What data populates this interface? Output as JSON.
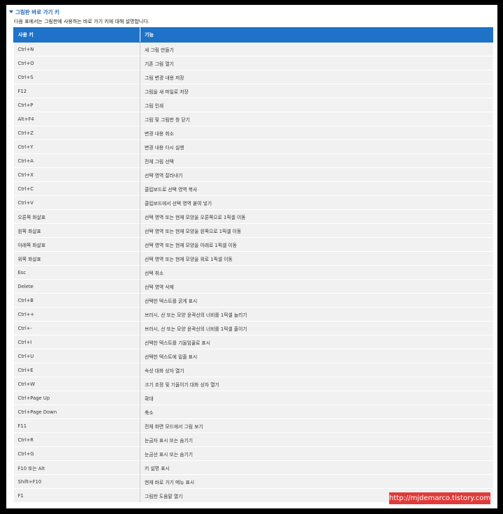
{
  "section": {
    "title": "그림판 바로 가기 키"
  },
  "intro": "다음 표에서는 그림판에 사용하는 바로 가기 키에 대해 설명합니다.",
  "columns": [
    "사용 키",
    "기능"
  ],
  "rows": [
    [
      "Ctrl+N",
      "새 그림 만들기"
    ],
    [
      "Ctrl+O",
      "기존 그림 열기"
    ],
    [
      "Ctrl+S",
      "그림 변경 내용 저장"
    ],
    [
      "F12",
      "그림을 새 파일로 저장"
    ],
    [
      "Ctrl+P",
      "그림 인쇄"
    ],
    [
      "Alt+F4",
      "그림 및 그림판 창 닫기"
    ],
    [
      "Ctrl+Z",
      "변경 내용 취소"
    ],
    [
      "Ctrl+Y",
      "변경 내용 다시 실행"
    ],
    [
      "Ctrl+A",
      "전체 그림 선택"
    ],
    [
      "Ctrl+X",
      "선택 영역 잘라내기"
    ],
    [
      "Ctrl+C",
      "클립보드로 선택 영역 복사"
    ],
    [
      "Ctrl+V",
      "클립보드에서 선택 영역 붙여 넣기"
    ],
    [
      "오른쪽 화살표",
      "선택 영역 또는 현재 모양을 오른쪽으로 1픽셀 이동"
    ],
    [
      "왼쪽 화살표",
      "선택 영역 또는 현재 모양을 왼쪽으로 1픽셀 이동"
    ],
    [
      "아래쪽 화살표",
      "선택 영역 또는 현재 모양을 아래로 1픽셀 이동"
    ],
    [
      "위쪽 화살표",
      "선택 영역 또는 현재 모양을 위로 1픽셀 이동"
    ],
    [
      "Esc",
      "선택 취소"
    ],
    [
      "Delete",
      "선택 영역 삭제"
    ],
    [
      "Ctrl+B",
      "선택한 텍스트를 굵게 표시"
    ],
    [
      "Ctrl++",
      "브러시, 선 또는 모양 윤곽선의 너비를 1픽셀 늘리기"
    ],
    [
      "Ctrl+-",
      "브러시, 선 또는 모양 윤곽선의 너비를 1픽셀 줄이기"
    ],
    [
      "Ctrl+I",
      "선택한 텍스트를 기울임꼴로 표시"
    ],
    [
      "Ctrl+U",
      "선택한 텍스트에 밑줄 표시"
    ],
    [
      "Ctrl+E",
      "속성 대화 상자 열기"
    ],
    [
      "Ctrl+W",
      "크기 조정 및 기울이기 대화 상자 열기"
    ],
    [
      "Ctrl+Page Up",
      "확대"
    ],
    [
      "Ctrl+Page Down",
      "축소"
    ],
    [
      "F11",
      "전체 화면 모드에서 그림 보기"
    ],
    [
      "Ctrl+R",
      "눈금자 표시 또는 숨기기"
    ],
    [
      "Ctrl+G",
      "눈금선 표시 또는 숨기기"
    ],
    [
      "F10 또는 Alt",
      "키 설명 표시"
    ],
    [
      "Shift+F10",
      "현재 바로 가기 메뉴 표시"
    ],
    [
      "F1",
      "그림판 도움말 열기"
    ]
  ],
  "watermark": "http://mjdemarco.tistory.com"
}
